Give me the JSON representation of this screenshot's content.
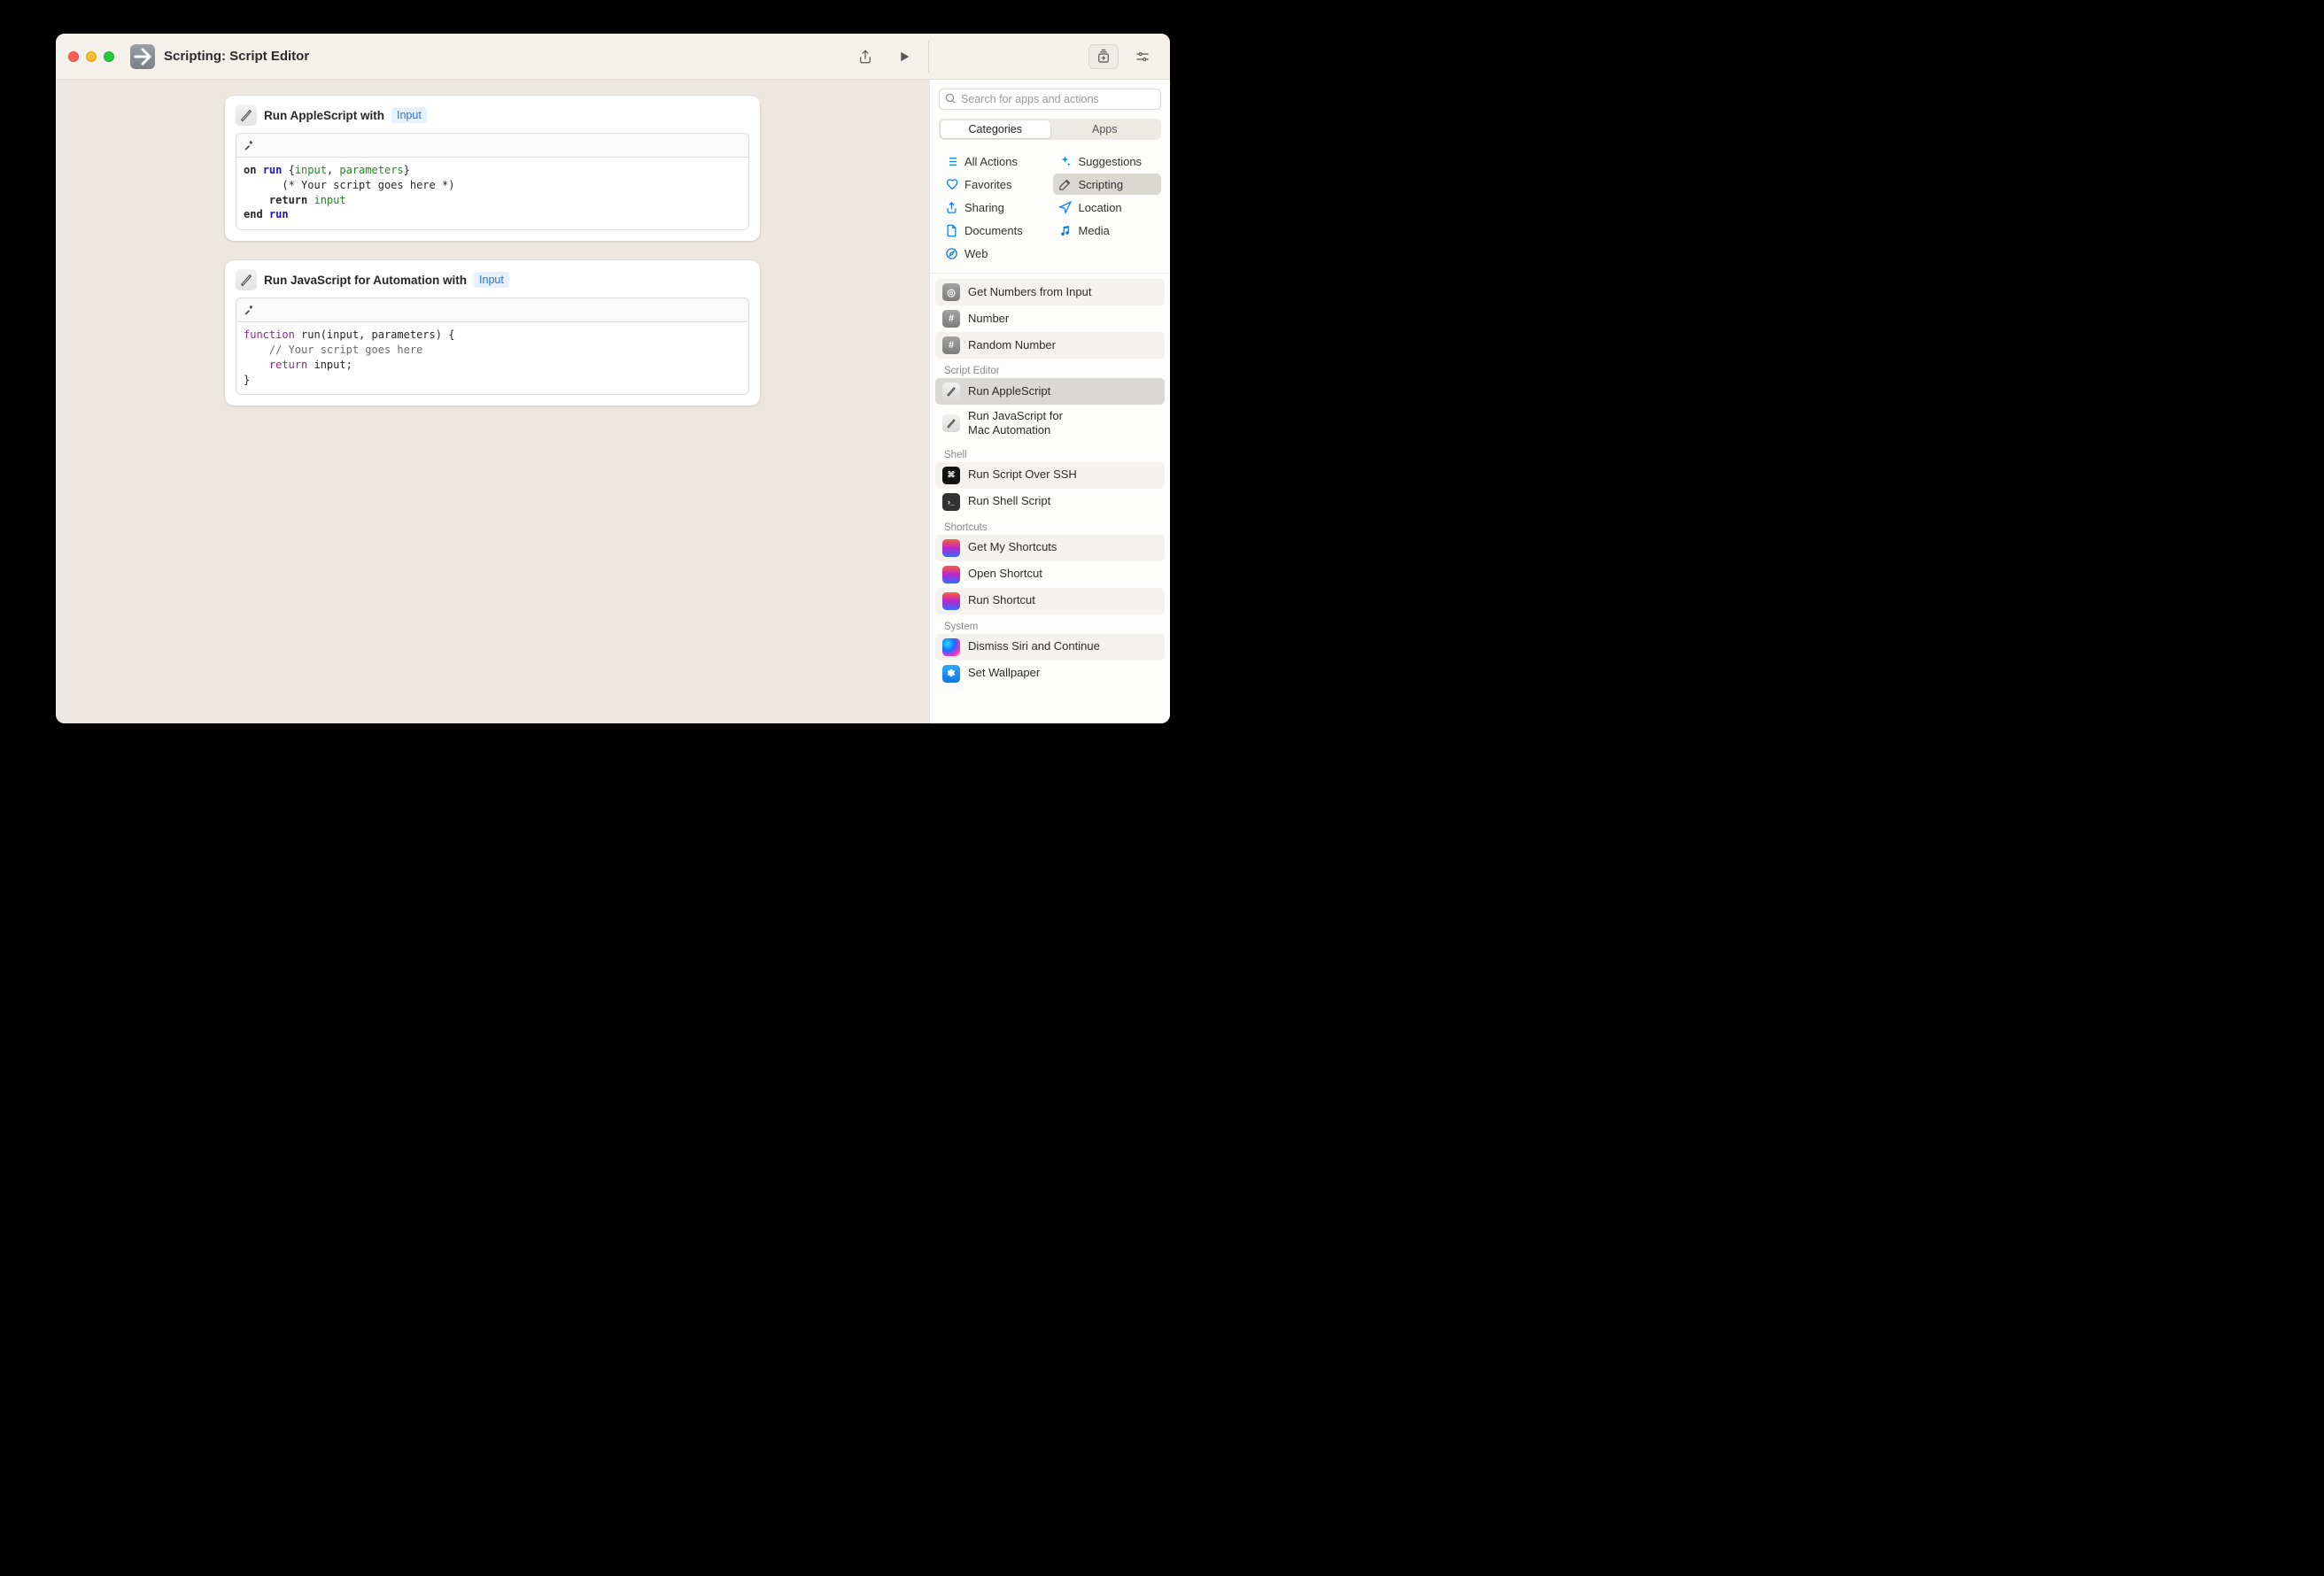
{
  "window": {
    "title": "Scripting: Script Editor"
  },
  "search": {
    "placeholder": "Search for apps and actions"
  },
  "tabs": {
    "categories": "Categories",
    "apps": "Apps"
  },
  "categories": {
    "all": "All Actions",
    "suggestions": "Suggestions",
    "favorites": "Favorites",
    "scripting": "Scripting",
    "sharing": "Sharing",
    "location": "Location",
    "documents": "Documents",
    "media": "Media",
    "web": "Web"
  },
  "cards": {
    "applescript": {
      "title": "Run AppleScript with",
      "token": "Input",
      "code_line1_a": "on ",
      "code_line1_b": "run",
      "code_line1_c": " {",
      "code_line1_d": "input",
      "code_line1_e": ", ",
      "code_line1_f": "parameters",
      "code_line1_g": "}",
      "code_line2": "      (* Your script goes here *)",
      "code_line3_a": "    return ",
      "code_line3_b": "input",
      "code_line4_a": "end ",
      "code_line4_b": "run"
    },
    "javascript": {
      "title": "Run JavaScript for Automation with",
      "token": "Input",
      "code_line1_a": "function",
      "code_line1_b": " run(input, parameters) {",
      "code_line2": "    // Your script goes here",
      "code_line3_a": "    return",
      "code_line3_b": " input;",
      "code_line4": "}"
    }
  },
  "list": {
    "get_numbers": "Get Numbers from Input",
    "number": "Number",
    "random_number": "Random Number",
    "sec_script_editor": "Script Editor",
    "run_applescript": "Run AppleScript",
    "run_jxa": "Run JavaScript for\nMac Automation",
    "sec_shell": "Shell",
    "run_ssh": "Run Script Over SSH",
    "run_shell": "Run Shell Script",
    "sec_shortcuts": "Shortcuts",
    "get_shortcuts": "Get My Shortcuts",
    "open_shortcut": "Open Shortcut",
    "run_shortcut": "Run Shortcut",
    "sec_system": "System",
    "dismiss_siri": "Dismiss Siri and Continue",
    "set_wallpaper": "Set Wallpaper"
  }
}
